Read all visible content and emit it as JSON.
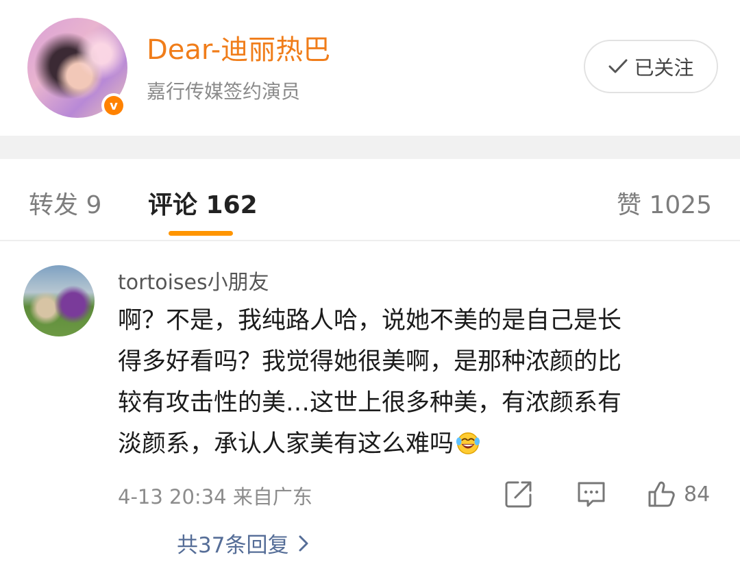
{
  "header": {
    "user_name": "Dear-迪丽热巴",
    "user_desc": "嘉行传媒签约演员",
    "verified_badge": "v",
    "follow_label": "已关注"
  },
  "tabs": {
    "forward": "转发 9",
    "comments": "评论 162",
    "likes": "赞 1025"
  },
  "comment": {
    "username": "tortoises小朋友",
    "lines": [
      "啊？不是，我纯路人哈，说她不美的是自己是长",
      "得多好看吗？我觉得她很美啊，是那种浓颜的比",
      "较有攻击性的美…这世上很多种美，有浓颜系有",
      "淡颜系，承认人家美有这么难吗"
    ],
    "emoji": "laughing-tears",
    "meta": "4-13 20:34  来自广东",
    "like_count": "84",
    "replies_link": "共37条回复"
  },
  "colors": {
    "accent": "#ff9500",
    "username_orange": "#f07d1a",
    "link_blue": "#556d97"
  }
}
